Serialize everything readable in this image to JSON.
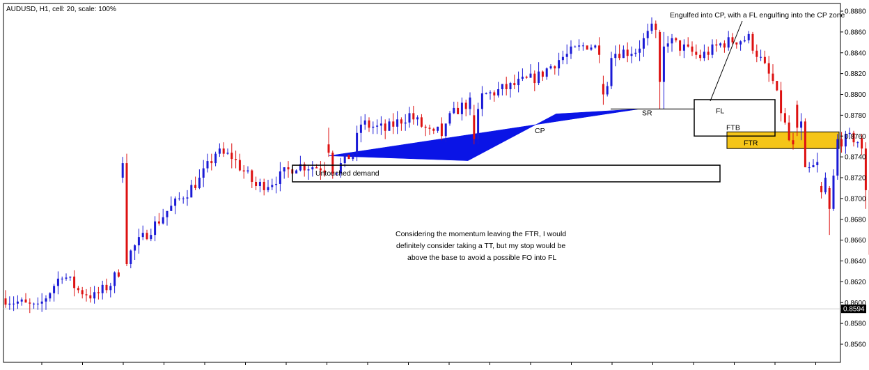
{
  "window_title": "AUDUSD, H1, cell: 20, scale: 100%",
  "chart_data": {
    "type": "candlestick",
    "symbol": "AUDUSD",
    "timeframe": "H1",
    "ylim": [
      0.855,
      0.8885
    ],
    "y_ticks": [
      "0.8880",
      "0.8860",
      "0.8840",
      "0.8820",
      "0.8800",
      "0.8780",
      "0.8760",
      "0.8740",
      "0.8720",
      "0.8700",
      "0.8680",
      "0.8660",
      "0.8640",
      "0.8620",
      "0.8600",
      "0.8580",
      "0.8560"
    ],
    "current_price": "0.8594",
    "current_price_value": 0.8594,
    "colors": {
      "up": "#1a1ad6",
      "down": "#dd1111",
      "cp_wedge": "#0a14e6",
      "ftr_zone": "#f5c518",
      "price_line": "#c8c8c8"
    },
    "grid": false,
    "candles": [],
    "key_levels": {
      "cp_low": 0.8741,
      "cp_low_bar": 80,
      "cp_high": 0.8786,
      "cp_high_bar": 157,
      "demand_top": 0.8732,
      "demand_bottom": 0.8716,
      "sr_level": 0.8786,
      "fl_top": 0.8795,
      "fl_bottom": 0.876,
      "ftr_top": 0.8764,
      "ftr_bottom": 0.8748
    },
    "annotations": {
      "untouched_demand": "Untouched demand",
      "cp": "CP",
      "sr": "SR",
      "fl": "FL",
      "ftb": "FTB",
      "ftr": "FTR",
      "engulfed_note": "Engulfed into CP, with a FL engulfing into the CP zone",
      "note_line1": "Considering the momentum leaving the FTR, I would",
      "note_line2": "definitely consider taking a TT, but my stop would be",
      "note_line3": "above the base to avoid a possible FO into FL"
    }
  }
}
